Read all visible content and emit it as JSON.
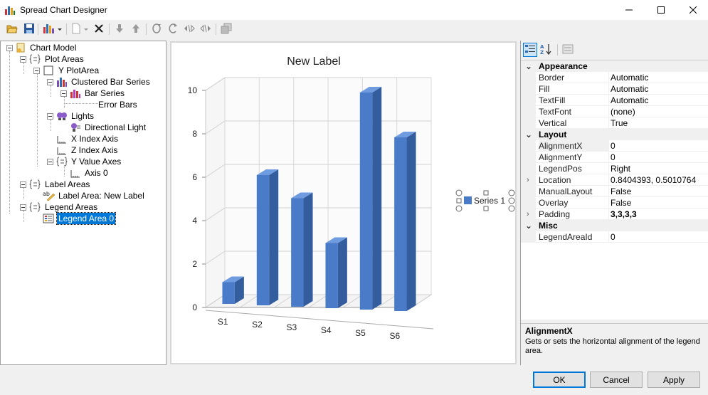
{
  "window": {
    "title": "Spread Chart Designer",
    "minimize_icon": "minimize-icon",
    "maximize_icon": "maximize-icon",
    "close_icon": "close-icon"
  },
  "toolbar": {
    "icons": [
      "open-folder-icon",
      "save-icon",
      "chart-type-icon",
      "dropdown-arrow-icon",
      "new-item-icon",
      "delete-icon",
      "move-down-icon",
      "move-up-icon",
      "rotate-x-icon",
      "rotate-y-icon",
      "rotate-left-icon",
      "rotate-right-icon",
      "copy-icon"
    ]
  },
  "tree": {
    "items": [
      {
        "label": "Chart Model",
        "icon": "chart-model-icon"
      },
      {
        "label": "Plot Areas",
        "icon": "collection-icon"
      },
      {
        "label": "Y PlotArea",
        "icon": "plot-area-icon"
      },
      {
        "label": "Clustered Bar Series",
        "icon": "bar-chart-icon"
      },
      {
        "label": "Bar Series",
        "icon": "bar-chart-icon"
      },
      {
        "label": "Error Bars",
        "icon": ""
      },
      {
        "label": "Lights",
        "icon": "lights-icon"
      },
      {
        "label": "Directional Light",
        "icon": "light-icon"
      },
      {
        "label": "X Index Axis",
        "icon": "axis-icon"
      },
      {
        "label": "Z Index Axis",
        "icon": "axis-icon"
      },
      {
        "label": "Y Value Axes",
        "icon": "collection-icon"
      },
      {
        "label": "Axis 0",
        "icon": "axis-icon"
      },
      {
        "label": "Label Areas",
        "icon": "collection-icon"
      },
      {
        "label": "Label Area: New Label",
        "icon": "label-icon"
      },
      {
        "label": "Legend Areas",
        "icon": "collection-icon"
      },
      {
        "label": "Legend Area 0",
        "icon": "legend-icon"
      }
    ],
    "selected": "Legend Area 0"
  },
  "chart_data": {
    "type": "bar",
    "title": "New Label",
    "categories": [
      "S1",
      "S2",
      "S3",
      "S4",
      "S5",
      "S6"
    ],
    "series": [
      {
        "name": "Series 1",
        "values": [
          1,
          6,
          5,
          3,
          10,
          8
        ]
      }
    ],
    "ylim": [
      0,
      10
    ],
    "yticks": [
      "0",
      "2",
      "4",
      "6",
      "8",
      "10"
    ],
    "grid": true,
    "legend_position": "right",
    "colors": {
      "bar_front": "#4a7bc8",
      "bar_side": "#345d9e",
      "bar_top": "#6f9be0"
    }
  },
  "properties": {
    "toolbar_icons": [
      "categorized-icon",
      "alphabetical-icon",
      "property-pages-icon"
    ],
    "categories": [
      {
        "name": "Appearance",
        "rows": [
          {
            "name": "Border",
            "value": "Automatic"
          },
          {
            "name": "Fill",
            "value": "Automatic"
          },
          {
            "name": "TextFill",
            "value": "Automatic"
          },
          {
            "name": "TextFont",
            "value": "(none)"
          },
          {
            "name": "Vertical",
            "value": "True"
          }
        ]
      },
      {
        "name": "Layout",
        "rows": [
          {
            "name": "AlignmentX",
            "value": "0"
          },
          {
            "name": "AlignmentY",
            "value": "0"
          },
          {
            "name": "LegendPos",
            "value": "Right"
          },
          {
            "name": "Location",
            "value": "0.8404393, 0.5010764"
          },
          {
            "name": "ManualLayout",
            "value": "False"
          },
          {
            "name": "Overlay",
            "value": "False"
          },
          {
            "name": "Padding",
            "value": "3,3,3,3"
          }
        ]
      },
      {
        "name": "Misc",
        "rows": [
          {
            "name": "LegendAreaId",
            "value": "0"
          }
        ]
      }
    ],
    "description": {
      "title": "AlignmentX",
      "text": "Gets or sets the horizontal alignment of the legend area."
    }
  },
  "buttons": {
    "ok": "OK",
    "cancel": "Cancel",
    "apply": "Apply"
  }
}
